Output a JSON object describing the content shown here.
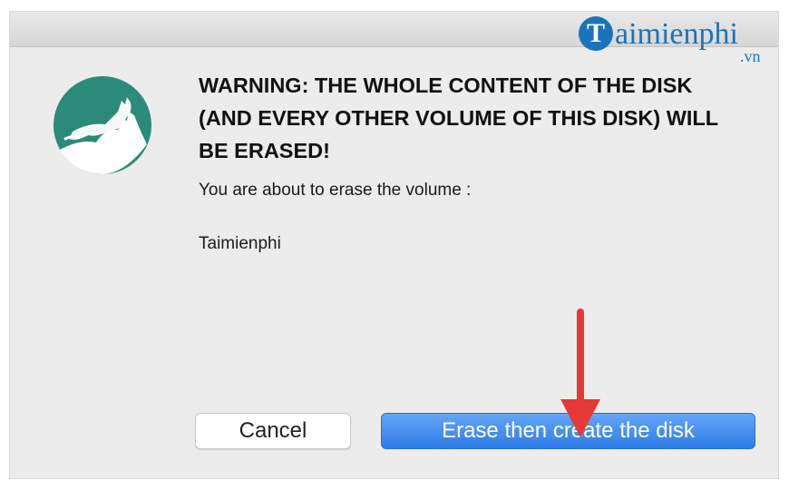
{
  "dialog": {
    "heading": "WARNING: THE WHOLE CONTENT OF THE DISK (AND EVERY OTHER VOLUME OF THIS DISK) WILL BE ERASED!",
    "message": "You are about to erase the volume :",
    "volume_name": "Taimienphi"
  },
  "buttons": {
    "cancel_label": "Cancel",
    "confirm_label": "Erase then create the disk"
  },
  "watermark": {
    "initial": "T",
    "brand_text": "aimienphi",
    "tld": ".vn"
  },
  "icons": {
    "app_icon": "mountain-lion-icon",
    "annotation": "red-arrow-down-icon"
  },
  "colors": {
    "icon_teal": "#2c8a78",
    "primary_blue": "#2f7be6",
    "arrow_red": "#e53935",
    "watermark_blue": "#1a74b9"
  }
}
